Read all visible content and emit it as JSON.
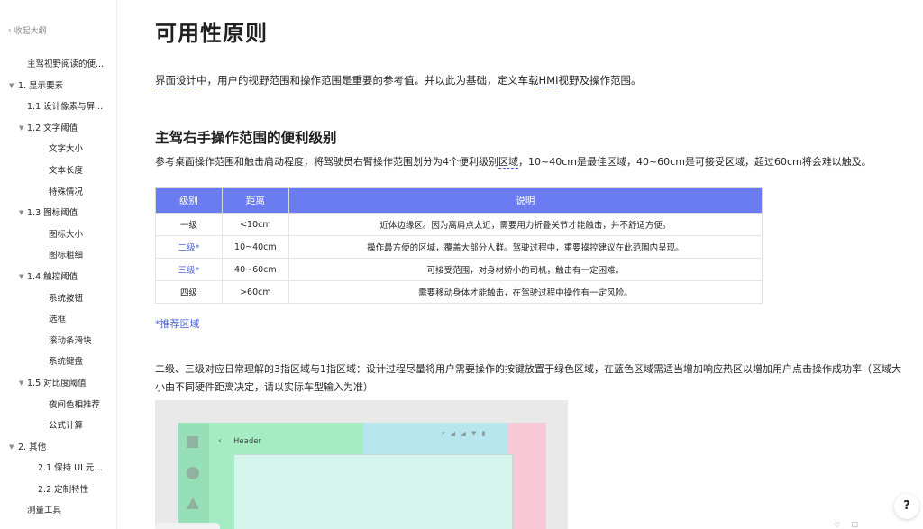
{
  "sidebar": {
    "collapse_label": "收起大纲",
    "items": [
      {
        "label": "主驾视野阅读的便...",
        "level": "lv0",
        "caret": ""
      },
      {
        "label": "1. 显示要素",
        "level": "lv1",
        "caret": "▼"
      },
      {
        "label": "1.1 设计像素与屏...",
        "level": "lv2",
        "caret": ""
      },
      {
        "label": "1.2 文字阈值",
        "level": "lv2b",
        "caret": "▼"
      },
      {
        "label": "文字大小",
        "level": "lv3",
        "caret": ""
      },
      {
        "label": "文本长度",
        "level": "lv3",
        "caret": ""
      },
      {
        "label": "特殊情况",
        "level": "lv3",
        "caret": ""
      },
      {
        "label": "1.3 图标阈值",
        "level": "lv2b",
        "caret": "▼"
      },
      {
        "label": "图标大小",
        "level": "lv3",
        "caret": ""
      },
      {
        "label": "图标粗细",
        "level": "lv3",
        "caret": ""
      },
      {
        "label": "1.4 触控阈值",
        "level": "lv2b",
        "caret": "▼"
      },
      {
        "label": "系统按钮",
        "level": "lv3",
        "caret": ""
      },
      {
        "label": "选框",
        "level": "lv3",
        "caret": ""
      },
      {
        "label": "滚动条滑块",
        "level": "lv3",
        "caret": ""
      },
      {
        "label": "系统键盘",
        "level": "lv3",
        "caret": ""
      },
      {
        "label": "1.5 对比度阈值",
        "level": "lv2b",
        "caret": "▼"
      },
      {
        "label": "夜间色相推荐",
        "level": "lv3",
        "caret": ""
      },
      {
        "label": "公式计算",
        "level": "lv3",
        "caret": ""
      },
      {
        "label": "2. 其他",
        "level": "lv1",
        "caret": "▼"
      },
      {
        "label": "2.1 保持 UI 元...",
        "level": "lv2c",
        "caret": ""
      },
      {
        "label": "2.2 定制特性",
        "level": "lv2c",
        "caret": ""
      },
      {
        "label": "测量工具",
        "level": "lv0b",
        "caret": ""
      }
    ]
  },
  "main": {
    "title": "可用性原则",
    "intro_a": "界面设计",
    "intro_b": "中，用户的视野范围和操作范围是重要的参考值。并以此为基础，定义车载",
    "intro_c": "HMI",
    "intro_d": "视野及操作范围。",
    "section_heading": "主驾右手操作范围的便利级别",
    "para_a": "参考桌面操作范围和触击肩动程度，将驾驶员右臂操作范围划分为4个便利级别",
    "para_b": "区域",
    "para_c": "，10~40cm是最佳区域，40~60cm是可接受区域，超过60cm将会难以触及。",
    "table": {
      "headers": [
        "级别",
        "距离",
        "说明"
      ],
      "rows": [
        {
          "level": "一级",
          "distance": "<10cm",
          "desc": "近体边缘区。因为离肩点太近，需要用力折叠关节才能触击，并不舒适方便。",
          "highlight": false
        },
        {
          "level": "二级*",
          "distance": "10~40cm",
          "desc": "操作最方便的区域，覆盖大部分人群。驾驶过程中，重要操控建议在此范围内呈现。",
          "highlight": true
        },
        {
          "level": "三级*",
          "distance": "40~60cm",
          "desc": "可接受范围，对身材娇小的司机，触击有一定困难。",
          "highlight": true
        },
        {
          "level": "四级",
          "distance": ">60cm",
          "desc": "需要移动身体才能触击，在驾驶过程中操作有一定风险。",
          "highlight": false
        }
      ]
    },
    "note": "*推荐区域",
    "para2": "二级、三级对应日常理解的3指区域与1指区域：设计过程尽量将用户需要操作的按键放置于绿色区域，在蓝色区域需适当增加响应热区以增加用户点击操作成功率（区域大小由不同硬件距离决定，请以实际车型输入为准）",
    "figure": {
      "back_glyph": "‹",
      "header_label": "Header"
    }
  },
  "colors": {
    "accent": "#6b7cf0",
    "link": "#4a63d8"
  },
  "help_label": "?"
}
